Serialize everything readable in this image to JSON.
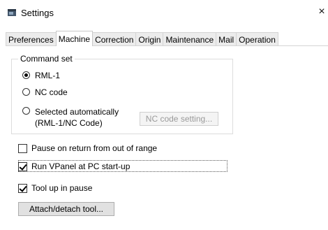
{
  "window": {
    "title": "Settings",
    "close_glyph": "×",
    "icon": "settings-window-icon"
  },
  "tabs": [
    {
      "label": "Preferences",
      "active": false
    },
    {
      "label": "Machine",
      "active": true
    },
    {
      "label": "Correction",
      "active": false
    },
    {
      "label": "Origin",
      "active": false
    },
    {
      "label": "Maintenance",
      "active": false
    },
    {
      "label": "Mail",
      "active": false
    },
    {
      "label": "Operation",
      "active": false
    }
  ],
  "command_set": {
    "label": "Command set",
    "options": [
      {
        "label": "RML-1",
        "checked": true
      },
      {
        "label": "NC code",
        "checked": false
      },
      {
        "label": "Selected automatically",
        "label_line2": "(RML-1/NC Code)",
        "checked": false
      }
    ],
    "nc_setting_button": "NC code setting..."
  },
  "options": {
    "pause_on_return": {
      "label": "Pause on return from out of range",
      "checked": false
    },
    "run_vpanel": {
      "label": "Run VPanel at PC start-up",
      "checked": true
    },
    "tool_up_in_pause": {
      "label": "Tool up in pause",
      "checked": true
    }
  },
  "attach_button": "Attach/detach tool..."
}
